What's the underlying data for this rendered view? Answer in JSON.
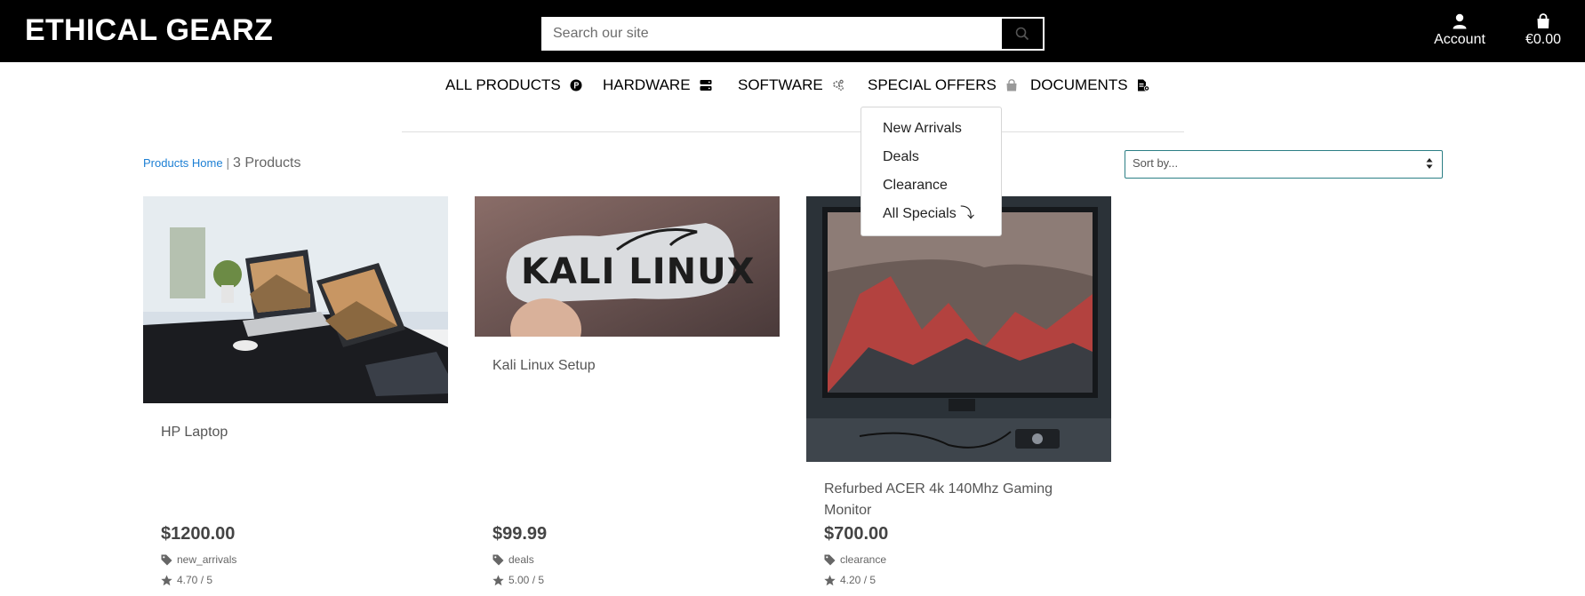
{
  "header": {
    "logo": "ETHICAL GEARZ",
    "search_placeholder": "Search our site",
    "account_label": "Account",
    "bag_total": "€0.00"
  },
  "nav": [
    {
      "label": "ALL PRODUCTS",
      "icon": "p-circle-icon"
    },
    {
      "label": "HARDWARE",
      "icon": "server-icon"
    },
    {
      "label": "SOFTWARE",
      "icon": "cogs-icon"
    },
    {
      "label": "SPECIAL OFFERS",
      "icon": "shopping-bag-icon"
    },
    {
      "label": "DOCUMENTS",
      "icon": "file-icon"
    }
  ],
  "dropdown": {
    "items": [
      "New Arrivals",
      "Deals",
      "Clearance",
      "All Specials ⤵"
    ]
  },
  "breadcrumb": {
    "home": "Products Home",
    "separator": "|",
    "count": "3 Products"
  },
  "sort": {
    "selected": "Sort by..."
  },
  "products": [
    {
      "name": "HP Laptop",
      "price": "$1200.00",
      "tag": "new_arrivals",
      "rating": "4.70 / 5"
    },
    {
      "name": "Kali Linux Setup",
      "price": "$99.99",
      "tag": "deals",
      "rating": "5.00 / 5"
    },
    {
      "name": "Refurbed ACER 4k 140Mhz Gaming Monitor",
      "price": "$700.00",
      "tag": "clearance",
      "rating": "4.20 / 5"
    }
  ],
  "colors": {
    "header_bg": "#000000",
    "link_blue": "#1c7fd4",
    "sort_border": "#2c7f85"
  }
}
